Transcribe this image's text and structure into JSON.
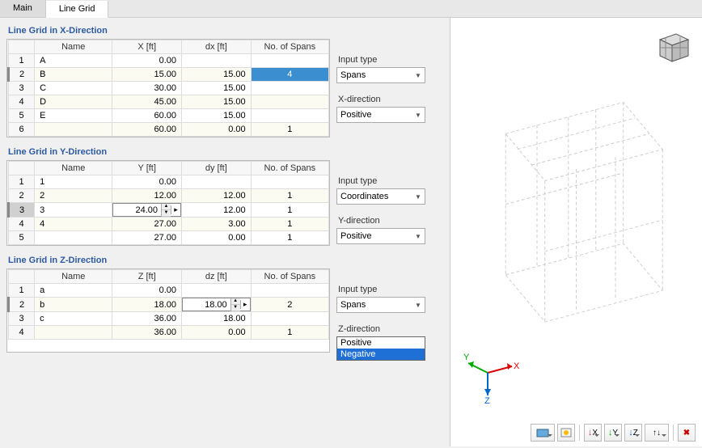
{
  "tabs": {
    "main": "Main",
    "linegrid": "Line Grid"
  },
  "x": {
    "title": "Line Grid in X-Direction",
    "cols": {
      "name": "Name",
      "v": "X [ft]",
      "d": "dx [ft]",
      "s": "No. of Spans"
    },
    "rows": [
      {
        "rh": "1",
        "name": "A",
        "v": "0.00",
        "d": "",
        "s": ""
      },
      {
        "rh": "2",
        "name": "B",
        "v": "15.00",
        "d": "15.00",
        "s": "4",
        "hl": true
      },
      {
        "rh": "3",
        "name": "C",
        "v": "30.00",
        "d": "15.00",
        "s": ""
      },
      {
        "rh": "4",
        "name": "D",
        "v": "45.00",
        "d": "15.00",
        "s": ""
      },
      {
        "rh": "5",
        "name": "E",
        "v": "60.00",
        "d": "15.00",
        "s": ""
      },
      {
        "rh": "6",
        "name": "",
        "v": "60.00",
        "d": "0.00",
        "s": "1"
      }
    ],
    "ctrl": {
      "inputtype_label": "Input type",
      "inputtype_value": "Spans",
      "dir_label": "X-direction",
      "dir_value": "Positive"
    }
  },
  "y": {
    "title": "Line Grid in Y-Direction",
    "cols": {
      "name": "Name",
      "v": "Y [ft]",
      "d": "dy [ft]",
      "s": "No. of Spans"
    },
    "rows": [
      {
        "rh": "1",
        "name": "1",
        "v": "0.00",
        "d": "",
        "s": ""
      },
      {
        "rh": "2",
        "name": "2",
        "v": "12.00",
        "d": "12.00",
        "s": "1"
      },
      {
        "rh": "3",
        "name": "3",
        "v": "24.00",
        "d": "12.00",
        "s": "1",
        "edit": true
      },
      {
        "rh": "4",
        "name": "4",
        "v": "27.00",
        "d": "3.00",
        "s": "1"
      },
      {
        "rh": "5",
        "name": "",
        "v": "27.00",
        "d": "0.00",
        "s": "1"
      }
    ],
    "editval": "24.00",
    "ctrl": {
      "inputtype_label": "Input type",
      "inputtype_value": "Coordinates",
      "dir_label": "Y-direction",
      "dir_value": "Positive"
    }
  },
  "z": {
    "title": "Line Grid in Z-Direction",
    "cols": {
      "name": "Name",
      "v": "Z [ft]",
      "d": "dz [ft]",
      "s": "No. of Spans"
    },
    "rows": [
      {
        "rh": "1",
        "name": "a",
        "v": "0.00",
        "d": "",
        "s": ""
      },
      {
        "rh": "2",
        "name": "b",
        "v": "18.00",
        "d": "18.00",
        "s": "2",
        "editd": true
      },
      {
        "rh": "3",
        "name": "c",
        "v": "36.00",
        "d": "18.00",
        "s": ""
      },
      {
        "rh": "4",
        "name": "",
        "v": "36.00",
        "d": "0.00",
        "s": "1"
      }
    ],
    "editval": "18.00",
    "ctrl": {
      "inputtype_label": "Input type",
      "inputtype_value": "Spans",
      "dir_label": "Z-direction",
      "dir_value": "Negative"
    },
    "dropdown": {
      "opt1": "Positive",
      "opt2": "Negative"
    }
  },
  "axes": {
    "x": "X",
    "y": "Y",
    "z": "Z"
  }
}
